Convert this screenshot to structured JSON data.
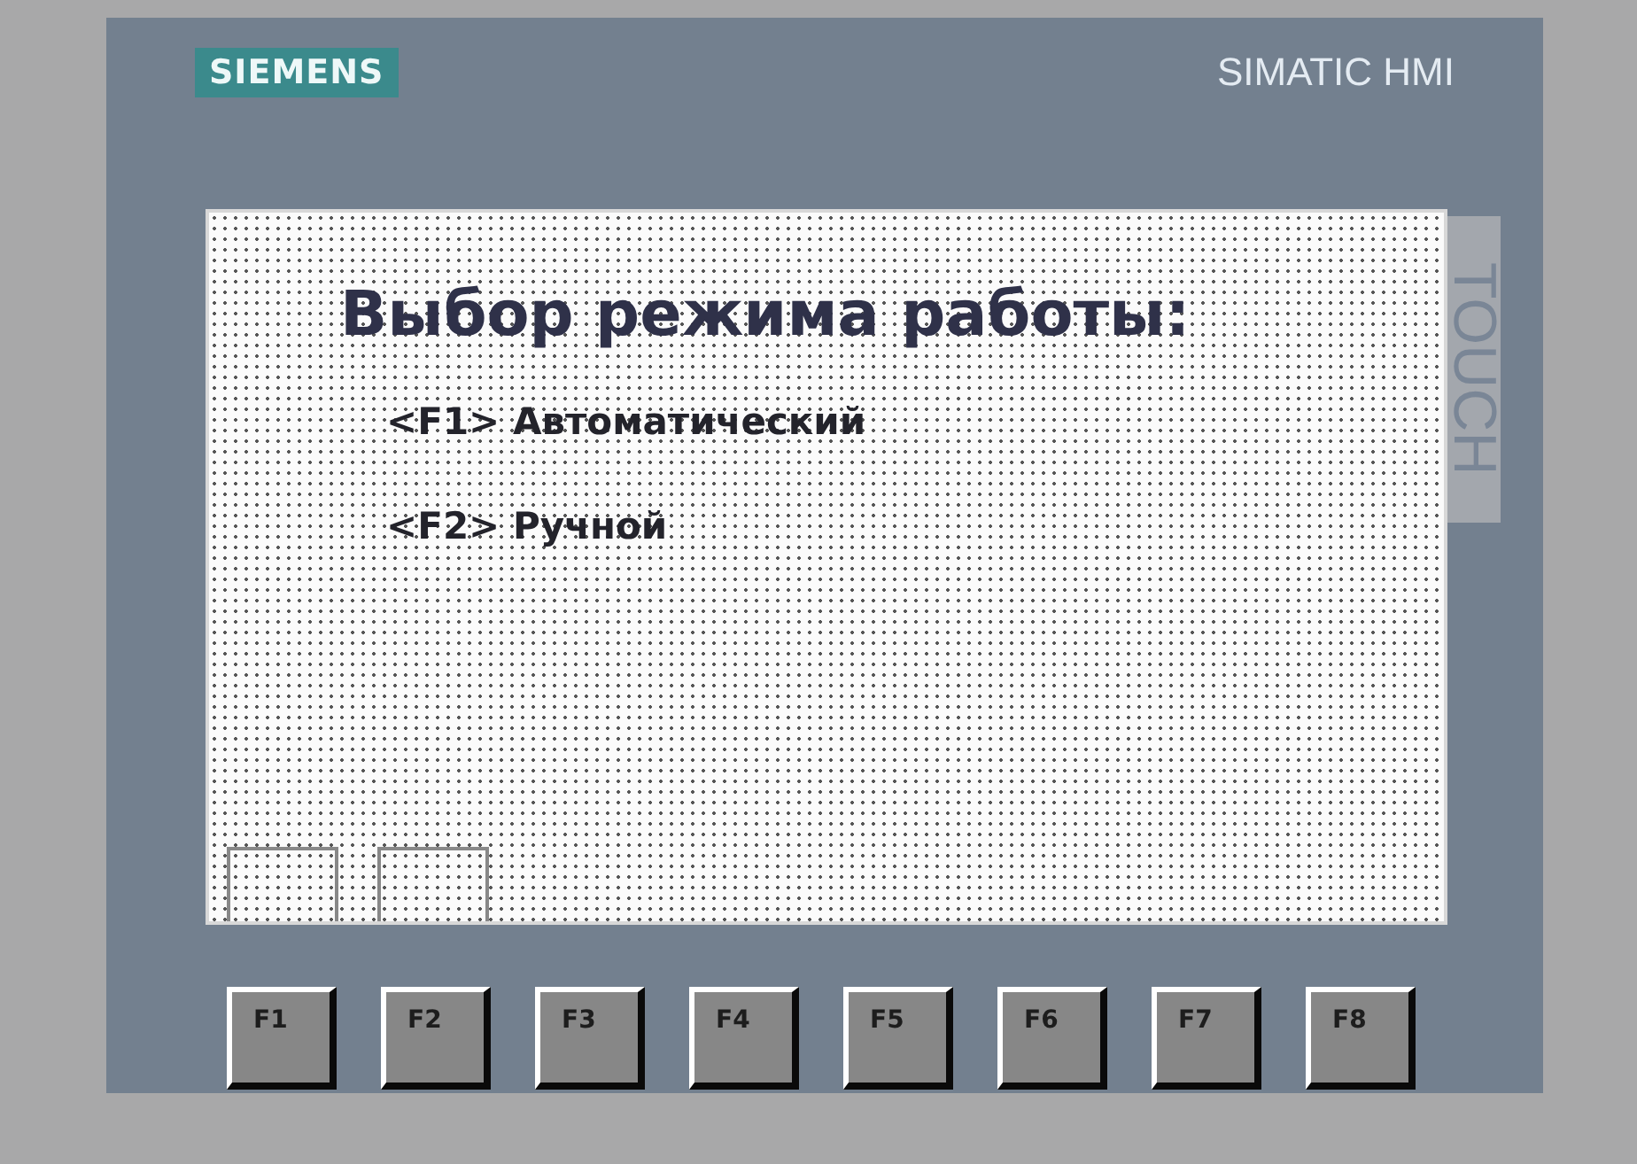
{
  "header": {
    "logo": "SIEMENS",
    "product": "SIMATIC HMI"
  },
  "side_label": "TOUCH",
  "screen": {
    "title": "Выбор режима работы:",
    "options": [
      "<F1> Автоматический",
      "<F2> Ручной"
    ]
  },
  "function_keys": [
    "F1",
    "F2",
    "F3",
    "F4",
    "F5",
    "F6",
    "F7",
    "F8"
  ]
}
